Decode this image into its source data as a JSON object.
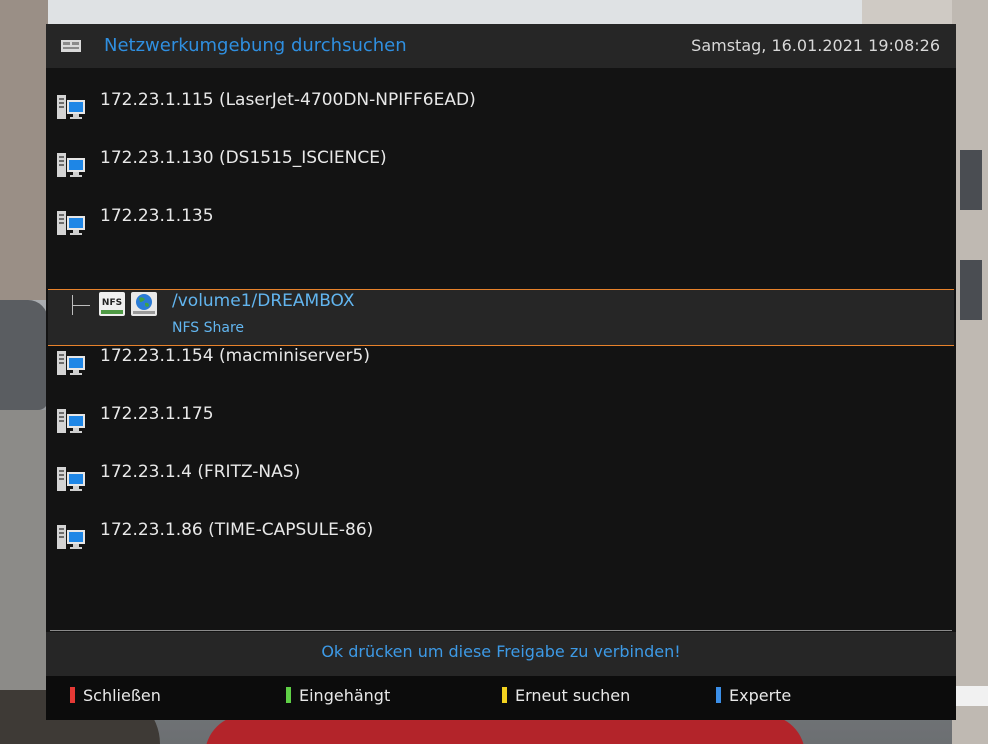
{
  "window": {
    "title": "Netzwerkumgebung durchsuchen",
    "datetime": "Samstag, 16.01.2021  19:08:26",
    "title_icon": "network-scan-icon"
  },
  "hosts": [
    {
      "label": "172.23.1.115 (LaserJet-4700DN-NPIFF6EAD)",
      "icon": "computer-icon"
    },
    {
      "label": "172.23.1.130 (DS1515_ISCIENCE)",
      "icon": "computer-icon"
    },
    {
      "label": "172.23.1.135",
      "icon": "computer-icon"
    },
    {
      "label": "172.23.1.154 (macminiserver5)",
      "icon": "computer-icon"
    },
    {
      "label": "172.23.1.175",
      "icon": "computer-icon"
    },
    {
      "label": "172.23.1.4 (FRITZ-NAS)",
      "icon": "computer-icon"
    },
    {
      "label": "172.23.1.86 (TIME-CAPSULE-86)",
      "icon": "computer-icon"
    }
  ],
  "selected_share": {
    "path": "/volume1/DREAMBOX",
    "type": "NFS Share",
    "badge": "NFS",
    "icons": [
      "nfs-share-icon",
      "globe-icon"
    ]
  },
  "hint": "Ok drücken um diese Freigabe zu verbinden!",
  "buttons": {
    "red": {
      "label": "Schließen",
      "color": "#e53935"
    },
    "green": {
      "label": "Eingehängt",
      "color": "#5fd046"
    },
    "yellow": {
      "label": "Erneut suchen",
      "color": "#f3d21f"
    },
    "blue": {
      "label": "Experte",
      "color": "#3b8fe8"
    }
  },
  "colors": {
    "accent_blue": "#2f8fe0",
    "selection_border": "#e8822b"
  }
}
